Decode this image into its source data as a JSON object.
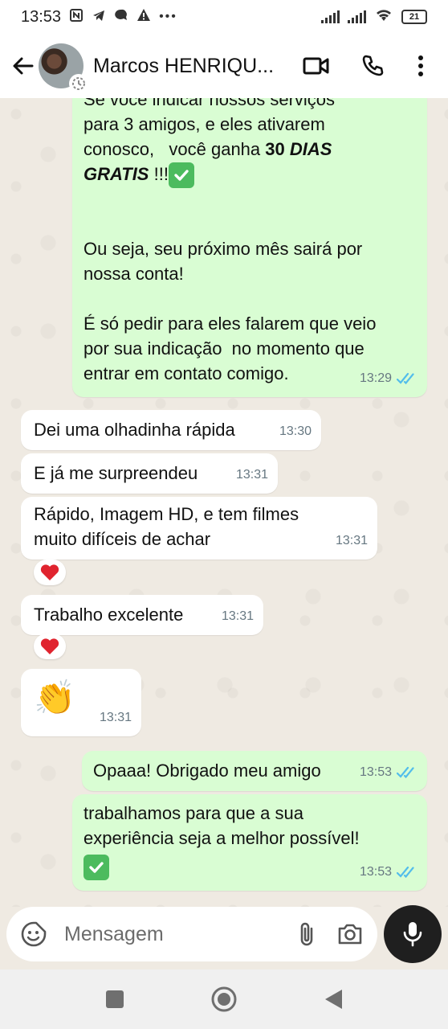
{
  "status_bar": {
    "time": "13:53",
    "battery": "21"
  },
  "header": {
    "contact_name": "Marcos HENRIQU..."
  },
  "messages": [
    {
      "direction": "out",
      "text": "Se você indicar nossos serviços\npara 3 amigos, e eles ativarem\nconosco,   você ganha 30 DIAS\nGRATIS !!!",
      "text_bold_part": "30 DIAS GRATIS",
      "text2": "Ou seja, seu próximo mês sairá por\nnossa conta!\n\nÉ só pedir para eles falarem que veio\npor sua indicação  no momento que\nentrar em contato comigo.",
      "time": "13:29",
      "status": "read"
    },
    {
      "direction": "in",
      "text": "Dei uma olhadinha rápida",
      "time": "13:30"
    },
    {
      "direction": "in",
      "text": "E já me surpreendeu",
      "time": "13:31"
    },
    {
      "direction": "in",
      "text": "Rápido, Imagem HD, e tem filmes\nmuito difíceis de achar",
      "time": "13:31",
      "reaction": "heart"
    },
    {
      "direction": "in",
      "text": "Trabalho excelente",
      "time": "13:31",
      "reaction": "heart"
    },
    {
      "direction": "in",
      "text": "👏",
      "time": "13:31"
    },
    {
      "direction": "out",
      "text": "Opaaa! Obrigado meu amigo",
      "time": "13:53",
      "status": "read"
    },
    {
      "direction": "out",
      "text": "trabalhamos para que a sua\nexperiência seja a melhor possível!",
      "time": "13:53",
      "status": "read"
    }
  ],
  "composer": {
    "placeholder": "Mensagem"
  },
  "colors": {
    "outgoing_bubble": "#d9fdd3",
    "incoming_bubble": "#ffffff",
    "read_ticks": "#53bdeb",
    "chat_background": "#efeae2"
  }
}
